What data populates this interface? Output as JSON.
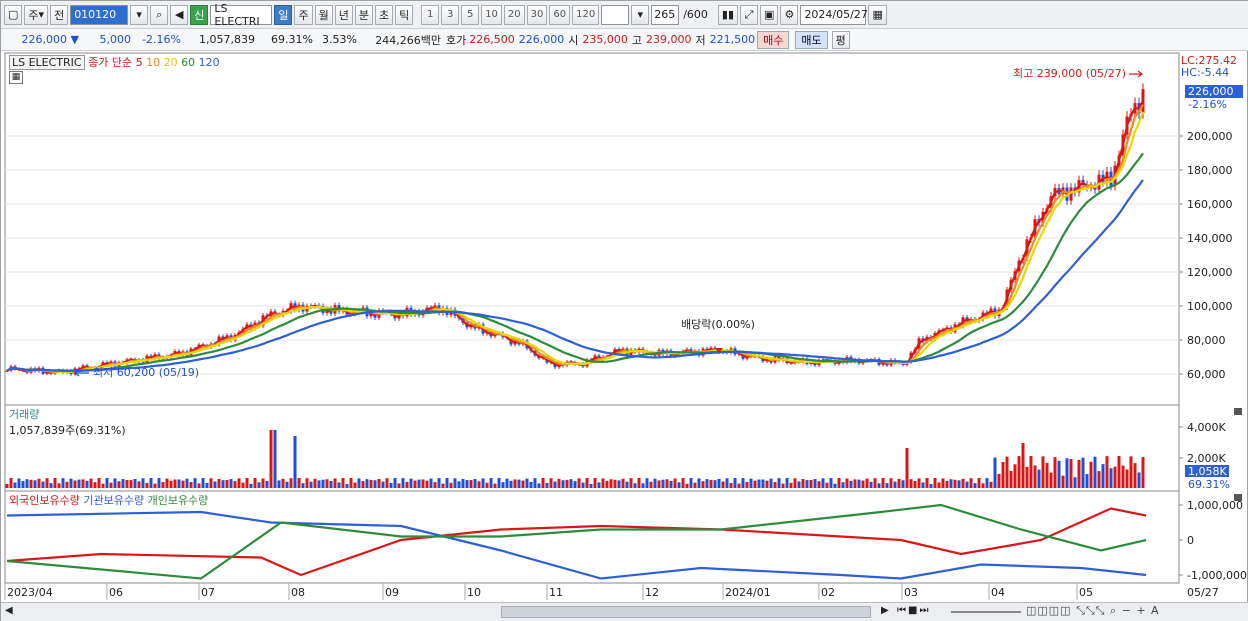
{
  "toolbar": {
    "market_label": "주",
    "prev_label": "전",
    "code_value": "010120",
    "stock_name": "LS ELECTRI",
    "new_badge": "신",
    "periods": [
      "일",
      "주",
      "월",
      "년",
      "분",
      "초",
      "틱"
    ],
    "active_period": "일",
    "intervals": [
      "1",
      "3",
      "5",
      "10",
      "20",
      "30",
      "60",
      "120"
    ],
    "count_value": "265",
    "count_total": "/600",
    "date_value": "2024/05/27"
  },
  "quote": {
    "price": "226,000 ▼",
    "change": "5,000",
    "change_pct": "-2.16%",
    "volume": "1,057,839",
    "vol_ratio": "69.31%",
    "turnover_pct": "3.53%",
    "trade_value": "244,266백만",
    "ask_label": "호가",
    "ask": "226,500",
    "bid": "226,000",
    "open_label": "시",
    "open": "235,000",
    "high_label": "고",
    "high": "239,000",
    "low_label": "저",
    "low": "221,500",
    "buy_label": "매수",
    "sell_label": "매도",
    "eval_label": "평"
  },
  "price_panel": {
    "title": "LS ELECTRIC",
    "ma_label": "종가 단순",
    "ma_periods": [
      "5",
      "10",
      "20",
      "60",
      "120"
    ],
    "ma_colors": [
      "#d81818",
      "#f08a24",
      "#e6d800",
      "#2e8b3e",
      "#2f5fd6"
    ],
    "lc_label": "LC:275.42",
    "hc_label": "HC:-5.44",
    "current_price_tag": "226,000",
    "current_pct_tag": "-2.16%",
    "high_annotation": "최고 239,000 (05/27)",
    "low_annotation": "최저 60,200 (05/19)",
    "dividend_annotation": "배당락(0.00%)",
    "y_ticks": [
      "200,000",
      "180,000",
      "160,000",
      "140,000",
      "120,000",
      "100,000",
      "80,000",
      "60,000"
    ]
  },
  "volume_panel": {
    "title": "거래량",
    "value_label": "1,057,839주(69.31%)",
    "y_ticks": [
      "4,000K",
      "2,000K"
    ],
    "current_tag": "1,058K",
    "current_pct": "69.31%"
  },
  "holding_panel": {
    "series_labels": [
      "외국인보유수량",
      "기관보유수량",
      "개인보유수량"
    ],
    "series_colors": [
      "#d81818",
      "#2f5fd6",
      "#2e8b3e"
    ],
    "y_ticks": [
      "1,000,000",
      "0",
      "-1,000,000"
    ]
  },
  "x_axis": {
    "labels": [
      "2023/04",
      "06",
      "07",
      "08",
      "09",
      "10",
      "11",
      "12",
      "2024/01",
      "02",
      "03",
      "04",
      "05",
      "05/27"
    ]
  },
  "colors": {
    "up": "#d81818",
    "down": "#1f4fd6",
    "accent": "#3d7cc9"
  }
}
